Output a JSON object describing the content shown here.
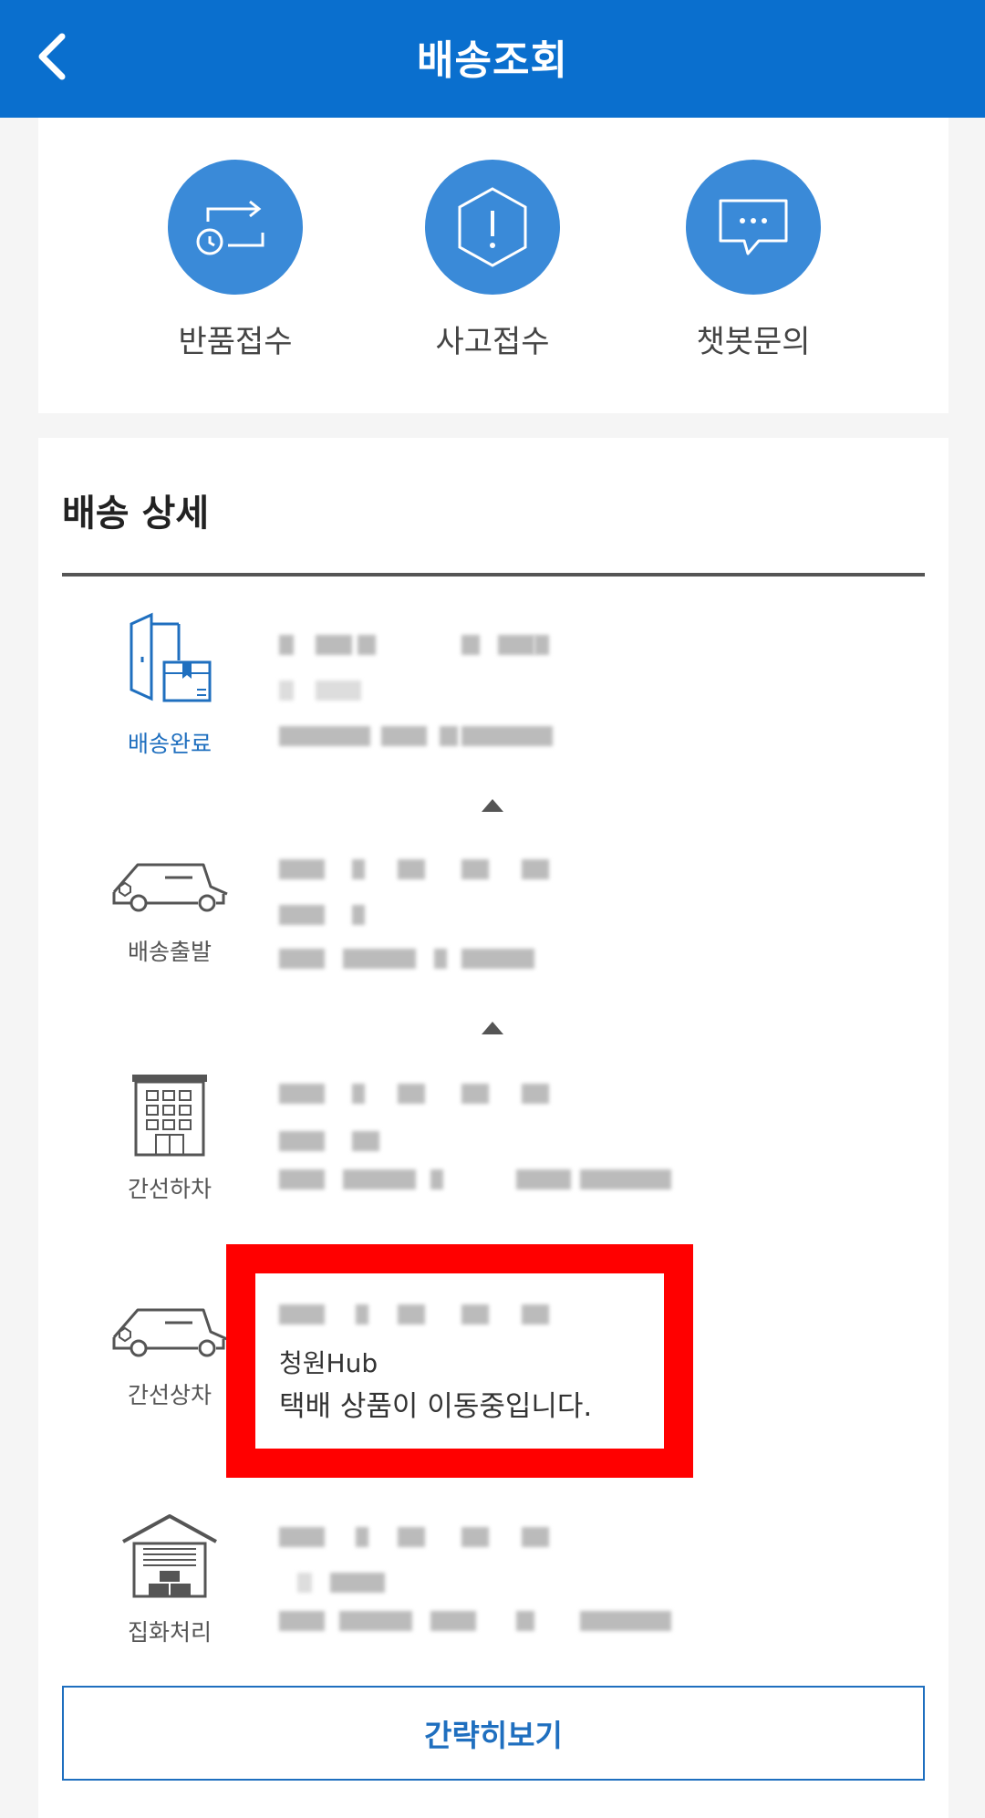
{
  "header": {
    "title": "배송조회"
  },
  "actions": [
    {
      "label": "반품접수",
      "icon": "return-exchange-icon"
    },
    {
      "label": "사고접수",
      "icon": "accident-report-icon"
    },
    {
      "label": "챗봇문의",
      "icon": "chatbot-icon"
    }
  ],
  "details": {
    "title": "배송 상세",
    "steps": [
      {
        "label": "배송완료",
        "icon": "delivery-complete-icon"
      },
      {
        "label": "배송출발",
        "icon": "delivery-truck-icon"
      },
      {
        "label": "간선하차",
        "icon": "building-icon"
      },
      {
        "label": "간선상차",
        "icon": "delivery-truck-icon"
      },
      {
        "label": "집화처리",
        "icon": "warehouse-icon"
      }
    ],
    "highlighted": {
      "location": "청원Hub",
      "message": "택배 상품이 이동중입니다."
    }
  },
  "buttons": {
    "simple_view": "간략히보기"
  },
  "colors": {
    "header": "#0a6fce",
    "accent": "#1f6fbf",
    "highlight": "#ff0000"
  }
}
